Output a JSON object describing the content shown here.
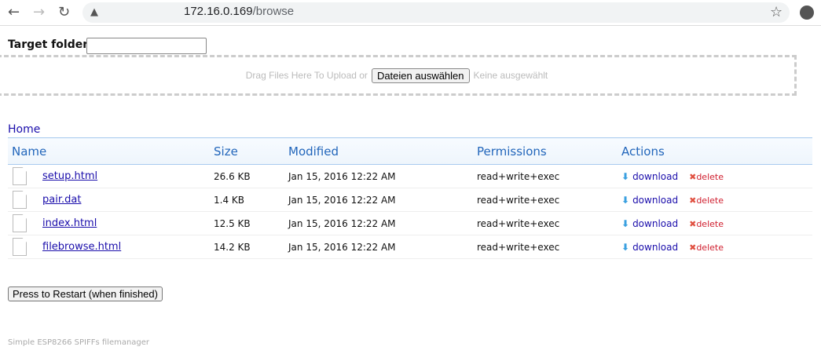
{
  "browser": {
    "url_host": "172.16.0.169",
    "url_path": "/browse"
  },
  "form": {
    "target_label": "Target folder",
    "target_value": "",
    "drop_text": "Drag Files Here To Upload or",
    "choose_button": "Dateien auswählen",
    "no_file": "Keine ausgewählt"
  },
  "breadcrumb": "Home",
  "table": {
    "headers": [
      "Name",
      "Size",
      "Modified",
      "Permissions",
      "Actions"
    ],
    "rows": [
      {
        "name": "setup.html",
        "size": "26.6 KB",
        "modified": "Jan 15, 2016 12:22 AM",
        "perm": "read+write+exec"
      },
      {
        "name": "pair.dat",
        "size": "1.4 KB",
        "modified": "Jan 15, 2016 12:22 AM",
        "perm": "read+write+exec"
      },
      {
        "name": "index.html",
        "size": "12.5 KB",
        "modified": "Jan 15, 2016 12:22 AM",
        "perm": "read+write+exec"
      },
      {
        "name": "filebrowse.html",
        "size": "14.2 KB",
        "modified": "Jan 15, 2016 12:22 AM",
        "perm": "read+write+exec"
      }
    ],
    "download_label": "download",
    "delete_label": "delete"
  },
  "restart_button": "Press to Restart (when finished)",
  "footer": "Simple ESP8266 SPIFFs filemanager"
}
